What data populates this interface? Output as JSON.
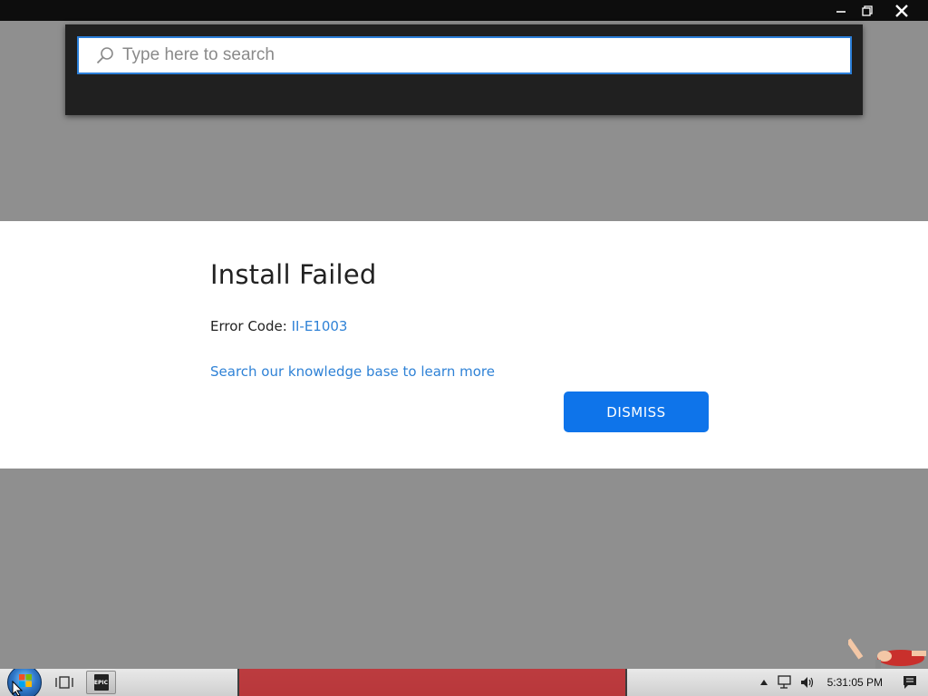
{
  "window": {
    "controls": {
      "minimize": "minimize-icon",
      "maximize": "restore-icon",
      "close": "close-icon"
    }
  },
  "search": {
    "placeholder": "Type here to search",
    "value": "",
    "icon": "search-icon"
  },
  "dialog": {
    "title": "Install Failed",
    "error_label": "Error Code: ",
    "error_code": "II-E1003",
    "kb_link": "Search our knowledge base to learn more",
    "dismiss_label": "DISMISS"
  },
  "taskbar": {
    "clock": "5:31:05 PM",
    "epic_label": "EPIC",
    "icons": [
      "start-orb-icon",
      "task-view-icon",
      "epic-games-icon",
      "show-hidden-icons",
      "network-icon",
      "volume-icon",
      "action-center-icon"
    ]
  },
  "colors": {
    "accent": "#0e74ea",
    "link": "#2f82d6",
    "overlay": "#8f8f8f",
    "search_panel": "#202020"
  }
}
